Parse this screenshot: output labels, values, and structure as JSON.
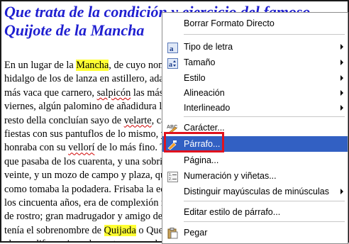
{
  "document": {
    "heading_lines": [
      "Que trata de la condición y ejercicio del famoso",
      "Quijote de la Mancha"
    ],
    "lines": [
      [
        "En un lugar de la ",
        {
          "t": "Mancha",
          "hl": true
        },
        ", de cuyo nombre no quiero acordarme"
      ],
      [
        "hidalgo de los de lanza en astillero, adarga antigua, rocín flaco"
      ],
      [
        "más vaca que carnero, ",
        {
          "t": "salpicón",
          "sq": true
        },
        " las más noches, duelos"
      ],
      [
        "viernes, algún palomino de añadidura los domingos, consumían"
      ],
      [
        "resto della concluían sayo de ",
        {
          "t": "velarte",
          "sq": true
        },
        ", calzas de velludo"
      ],
      [
        "fiestas con sus pantuflos de lo mismo, y los días de entre"
      ],
      [
        "honraba con su ",
        {
          "t": "vellorí",
          "sq": true
        },
        " de lo más fino. Tenía en su casa"
      ],
      [
        "que pasaba de los cuarenta, y una sobrina que no llegaba"
      ],
      [
        "veinte, y un mozo de campo y plaza, que así ensillaba el"
      ],
      [
        "como tomaba la podadera. Frisaba la edad de nuestro hidalgo"
      ],
      [
        "los cincuenta años, era de complexión recia, seco de carnes"
      ],
      [
        "de rostro; gran madrugador y amigo de la caza. Quieren decir"
      ],
      [
        "tenía el sobrenombre de ",
        {
          "t": "Quijada",
          "hl": true
        },
        " o Quesada, que en esto hay"
      ],
      [
        "alguna diferencia en los autores que deste caso escriben"
      ]
    ]
  },
  "menu": {
    "items": [
      {
        "id": "borrar-formato",
        "label": "Borrar Formato Directo",
        "icon": "",
        "submenu": false
      },
      {
        "id": "tipo-de-letra",
        "label": "Tipo de letra",
        "icon": "font-icon",
        "submenu": true
      },
      {
        "id": "tamano",
        "label": "Tamaño",
        "icon": "font-size-icon",
        "submenu": true
      },
      {
        "id": "estilo",
        "label": "Estilo",
        "icon": "",
        "submenu": true
      },
      {
        "id": "alineacion",
        "label": "Alineación",
        "icon": "",
        "submenu": true
      },
      {
        "id": "interlineado",
        "label": "Interlineado",
        "icon": "",
        "submenu": true
      },
      {
        "id": "caracter",
        "label": "Carácter...",
        "icon": "character-icon",
        "submenu": false
      },
      {
        "id": "parrafo",
        "label": "Párrafo...",
        "icon": "paragraph-icon",
        "submenu": false,
        "selected": true
      },
      {
        "id": "pagina",
        "label": "Página...",
        "icon": "",
        "submenu": false
      },
      {
        "id": "numeracion",
        "label": "Numeración y viñetas...",
        "icon": "numbering-icon",
        "submenu": false
      },
      {
        "id": "distinguir",
        "label": "Distinguir mayúsculas de minúsculas",
        "icon": "",
        "submenu": true
      },
      {
        "id": "editar-estilo",
        "label": "Editar estilo de párrafo...",
        "icon": "",
        "submenu": false
      },
      {
        "id": "pegar",
        "label": "Pegar",
        "icon": "paste-icon",
        "submenu": false
      }
    ]
  },
  "colors": {
    "heading": "#1f1fd0",
    "highlight": "#ffff33",
    "selection": "#3260c3",
    "callout": "#e0121e"
  }
}
